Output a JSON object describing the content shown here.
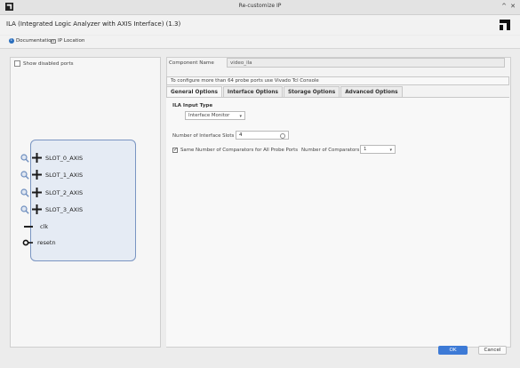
{
  "window": {
    "title": "Re-customize IP",
    "max_glyph": "^",
    "close_glyph": "✕"
  },
  "header": {
    "title": "ILA (Integrated Logic Analyzer with AXIS Interface) (1.3)"
  },
  "toolbar": {
    "documentation": "Documentation",
    "ip_location": "IP Location"
  },
  "left": {
    "show_disabled_ports": "Show disabled ports",
    "ports": [
      {
        "label": "SLOT_0_AXIS"
      },
      {
        "label": "SLOT_1_AXIS"
      },
      {
        "label": "SLOT_2_AXIS"
      },
      {
        "label": "SLOT_3_AXIS"
      }
    ],
    "clk_label": "clk",
    "resetn_label": "resetn"
  },
  "right": {
    "component_name_label": "Component Name",
    "component_name_value": "video_ila",
    "info_message": "To configure more than 64 probe ports use Vivado Tcl Console",
    "tabs": [
      {
        "label": "General Options"
      },
      {
        "label": "Interface Options"
      },
      {
        "label": "Storage Options"
      },
      {
        "label": "Advanced Options"
      }
    ],
    "ila_input_type_label": "ILA Input Type",
    "ila_input_type_value": "Interface Monitor",
    "num_slots_label": "Number of Interface Slots",
    "num_slots_value": "4",
    "same_comparators_label": "Same Number of Comparators for All Probe Ports",
    "num_comparators_label": "Number of Comparators",
    "num_comparators_value": "1"
  },
  "footer": {
    "ok_label": "OK",
    "cancel_label": "Cancel"
  },
  "colors": {
    "accent": "#3d7ad6",
    "block_fill": "#e5ebf4",
    "block_border": "#7a95c2"
  }
}
